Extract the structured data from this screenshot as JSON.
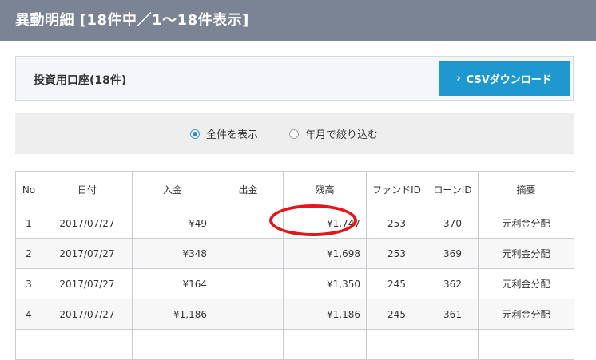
{
  "header": {
    "title": "異動明細 [18件中／1〜18件表示]"
  },
  "account": {
    "title": "投資用口座(18件)",
    "csv_label": "CSVダウンロード"
  },
  "filter": {
    "options": [
      {
        "label": "全件を表示",
        "selected": true
      },
      {
        "label": "年月で絞り込む",
        "selected": false
      }
    ]
  },
  "table": {
    "columns": [
      "No",
      "日付",
      "入金",
      "出金",
      "残高",
      "ファンドID",
      "ローンID",
      "摘要"
    ],
    "rows": [
      {
        "no": "1",
        "date": "2017/07/27",
        "deposit": "¥49",
        "withdrawal": "",
        "balance": "¥1,747",
        "fund_id": "253",
        "loan_id": "370",
        "summary": "元利金分配"
      },
      {
        "no": "2",
        "date": "2017/07/27",
        "deposit": "¥348",
        "withdrawal": "",
        "balance": "¥1,698",
        "fund_id": "253",
        "loan_id": "369",
        "summary": "元利金分配"
      },
      {
        "no": "3",
        "date": "2017/07/27",
        "deposit": "¥164",
        "withdrawal": "",
        "balance": "¥1,350",
        "fund_id": "245",
        "loan_id": "362",
        "summary": "元利金分配"
      },
      {
        "no": "4",
        "date": "2017/07/27",
        "deposit": "¥1,186",
        "withdrawal": "",
        "balance": "¥1,186",
        "fund_id": "245",
        "loan_id": "361",
        "summary": "元利金分配"
      },
      {
        "no": "",
        "date": "",
        "deposit": "",
        "withdrawal": "",
        "balance": "",
        "fund_id": "",
        "loan_id": "",
        "summary": ""
      }
    ]
  },
  "colors": {
    "header_bg": "#7b8494",
    "button_bg": "#1f98cf",
    "highlight": "#e5151c",
    "radio_selected": "#2f86e0"
  },
  "icons": {
    "csv_button": "chevron-right-icon",
    "radio_on": "radio-checked-icon",
    "radio_off": "radio-unchecked-icon"
  }
}
